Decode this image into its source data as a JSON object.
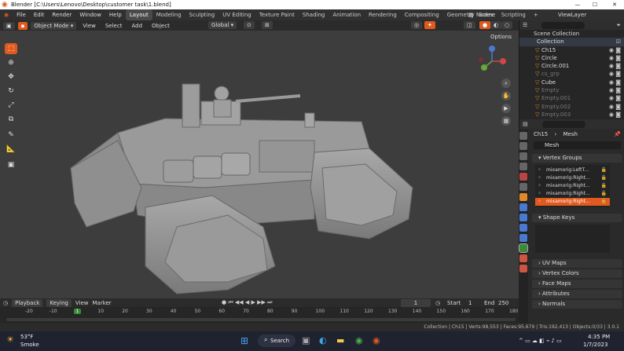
{
  "window": {
    "title": "Blender [C:\\Users\\Lenovo\\Desktop\\customer task\\1.blend]",
    "minimize": "—",
    "maximize": "☐",
    "close": "✕"
  },
  "menu": [
    "File",
    "Edit",
    "Render",
    "Window",
    "Help"
  ],
  "workspaces": [
    "Layout",
    "Modeling",
    "Sculpting",
    "UV Editing",
    "Texture Paint",
    "Shading",
    "Animation",
    "Rendering",
    "Compositing",
    "Geometry Nodes",
    "Scripting"
  ],
  "active_workspace": "Layout",
  "top_right": {
    "scene_label": "Scene",
    "viewlayer_label": "ViewLayer"
  },
  "viewport_header": {
    "mode": "Object Mode",
    "menus": [
      "View",
      "Select",
      "Add",
      "Object"
    ],
    "transform": "Global",
    "options": "Options"
  },
  "outliner": {
    "search_placeholder": "",
    "scene_collection": "Scene Collection",
    "collection": "Collection",
    "items": [
      {
        "name": "Ch15",
        "dim": false
      },
      {
        "name": "Circle",
        "dim": false
      },
      {
        "name": "Circle.001",
        "dim": false
      },
      {
        "name": "cs_grp",
        "dim": true
      },
      {
        "name": "Cube",
        "dim": false
      },
      {
        "name": "Empty",
        "dim": true
      },
      {
        "name": "Empty.001",
        "dim": true
      },
      {
        "name": "Empty.002",
        "dim": true
      },
      {
        "name": "Empty.003",
        "dim": true
      }
    ]
  },
  "properties": {
    "breadcrumb": [
      "Ch15",
      "Mesh"
    ],
    "data_name": "Mesh",
    "vertex_groups_title": "Vertex Groups",
    "vertex_groups": [
      {
        "name": "mixamorig:LeftT...",
        "selected": false
      },
      {
        "name": "mixamorig:Right...",
        "selected": false
      },
      {
        "name": "mixamorig:Right...",
        "selected": false
      },
      {
        "name": "mixamorig:Right...",
        "selected": false
      },
      {
        "name": "mixamorig:Right...",
        "selected": true
      }
    ],
    "panels": [
      "Shape Keys",
      "UV Maps",
      "Vertex Colors",
      "Face Maps",
      "Attributes",
      "Normals"
    ]
  },
  "timeline": {
    "menus": [
      "Playback",
      "Keying",
      "View",
      "Marker"
    ],
    "current_frame": "1",
    "start_label": "Start",
    "start": "1",
    "end_label": "End",
    "end": "250",
    "ruler": [
      "-20",
      "-10",
      "1",
      "10",
      "20",
      "30",
      "40",
      "50",
      "60",
      "70",
      "80",
      "90",
      "100",
      "110",
      "120",
      "130",
      "140",
      "150",
      "160",
      "170",
      "180"
    ]
  },
  "statusbar": {
    "text": "Collection | Ch15 | Verts:98,553 | Faces:95,679 | Tris:192,413 | Objects:0/33 | 3.0.1"
  },
  "taskbar": {
    "weather_temp": "53°F",
    "weather_desc": "Smoke",
    "search": "Search",
    "time": "4:35 PM",
    "date": "1/7/2023"
  },
  "colors": {
    "accent": "#e05a1f",
    "bg": "#3d3d3d"
  }
}
